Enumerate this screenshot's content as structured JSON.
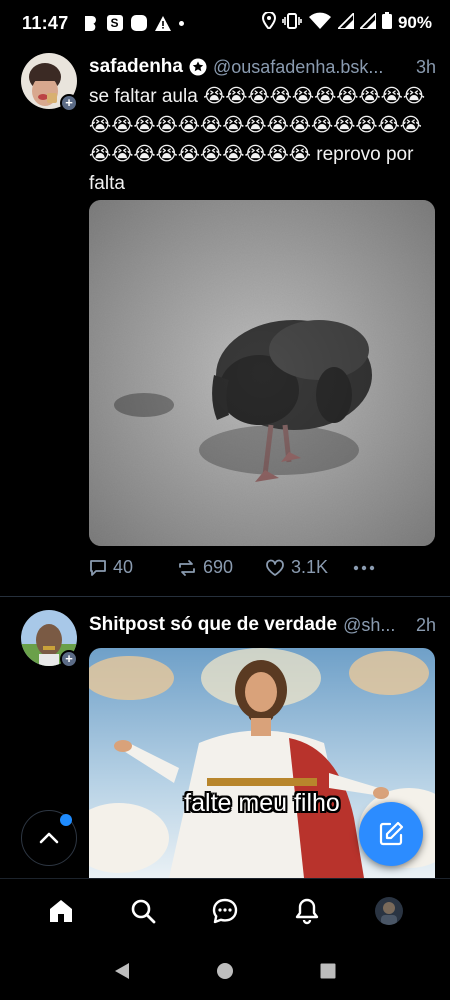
{
  "status_bar": {
    "time": "11:47",
    "battery": "90%",
    "left_icons": [
      "b-notification-icon",
      "s-notification-icon",
      "app-notification-icon",
      "warning-icon",
      "dot-icon"
    ],
    "right_icons": [
      "location-icon",
      "vibrate-icon",
      "wifi-call-icon",
      "signal-icon",
      "signal-icon-2"
    ]
  },
  "posts": [
    {
      "display_name": "safadenha",
      "handle": "@ousafadenha.bsk...",
      "time": "3h",
      "text": "se faltar aula 😭😭😭😭😭😭😭😭😭😭😭😭😭😭😭😭😭😭😭😭😭😭😭😭😭😭😭😭😭😭😭😭😭😭😭 reprovo por falta",
      "image": "pigeon-photo",
      "replies": "40",
      "reposts": "690",
      "likes": "3.1K"
    },
    {
      "display_name": "Shitpost só que de verdade",
      "handle": "@sh...",
      "time": "2h",
      "image_caption": "falte meu filho",
      "image": "jesus-painting"
    }
  ],
  "bottom_nav": [
    "home-icon",
    "search-icon",
    "chat-icon",
    "bell-icon",
    "profile-avatar"
  ],
  "colors": {
    "background": "#000000",
    "accent": "#2c8cff",
    "muted": "#8a9bb0",
    "divider": "#26303c"
  }
}
